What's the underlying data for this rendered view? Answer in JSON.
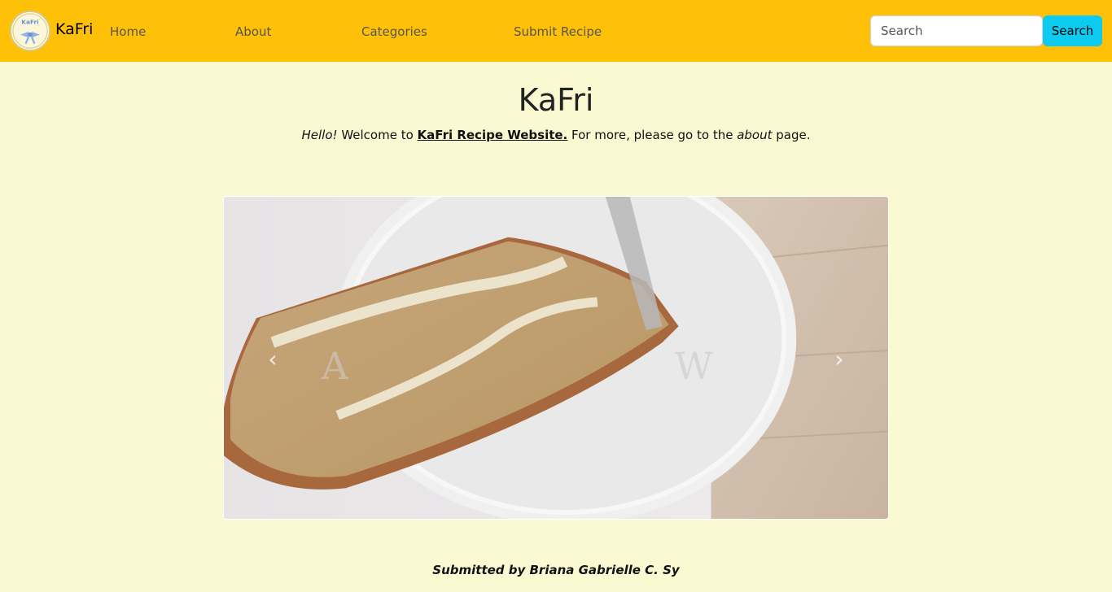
{
  "navbar": {
    "logo_icon": "kafri-bow-logo",
    "brand": "KaFri",
    "links": [
      {
        "label": "Home"
      },
      {
        "label": "About"
      },
      {
        "label": "Categories"
      },
      {
        "label": "Submit Recipe"
      }
    ],
    "search": {
      "placeholder": "Search",
      "value": ""
    },
    "search_button": "Search",
    "background": "#ffc107",
    "search_button_color": "#0dcaf0"
  },
  "main": {
    "title": "KaFri",
    "welcome": {
      "hello": "Hello!",
      "welcome_to": " Welcome to ",
      "site_link": "KaFri Recipe Website.",
      "for_more": " For more, please go to the ",
      "about": "about",
      "page": " page."
    },
    "carousel": {
      "prev_icon": "chevron-left-icon",
      "next_icon": "chevron-right-icon",
      "prev_glyph": "‹",
      "next_glyph": "›"
    },
    "submitted_by": "Submitted by Briana Gabrielle C. Sy"
  },
  "page_background": "#faf9d2"
}
